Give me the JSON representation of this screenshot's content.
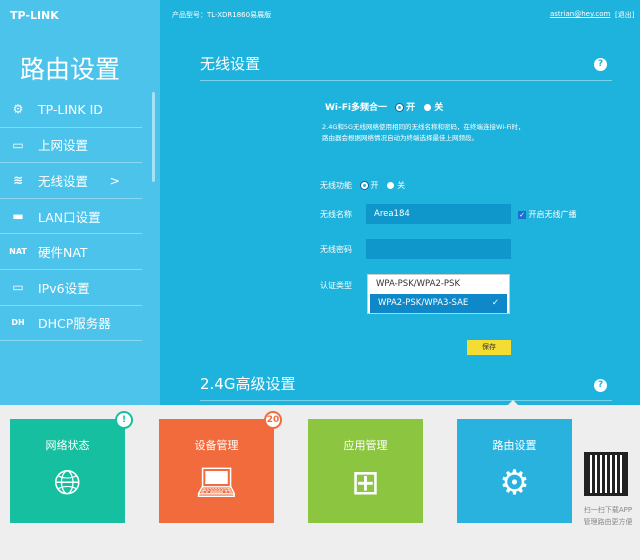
{
  "brand": "TP-LINK",
  "sidebar": {
    "title": "路由设置",
    "items": [
      {
        "icon": "gear-icon",
        "glyph": "⚙",
        "label": "TP-LINK ID"
      },
      {
        "icon": "laptop-icon",
        "glyph": "▭",
        "label": "上网设置"
      },
      {
        "icon": "wifi-icon",
        "glyph": "≋",
        "label": "无线设置",
        "chevron": ">"
      },
      {
        "icon": "switch-icon",
        "glyph": "▬",
        "label": "LAN口设置"
      },
      {
        "icon": "nat-icon",
        "glyph": "NAT",
        "label": "硬件NAT"
      },
      {
        "icon": "laptop-icon",
        "glyph": "▭",
        "label": "IPv6设置"
      },
      {
        "icon": "dhcp-icon",
        "glyph": "DH",
        "label": "DHCP服务器"
      }
    ]
  },
  "header": {
    "model": "产品型号：TL-XDR1860易展版",
    "user": "astrian@hey.com",
    "logout": "[退出]"
  },
  "wireless": {
    "title": "无线设置",
    "multiband_label": "Wi-Fi多频合一",
    "on": "开",
    "off": "关",
    "desc1": "2.4G和5G无线网络使用相同的无线名称和密码，在终端连接Wi-Fi时，",
    "desc2": "路由器会根据网络情况自动为终端选择最佳上网频段。",
    "func_label": "无线功能",
    "ssid_label": "无线名称",
    "ssid": "Area184",
    "broadcast": "开启无线广播",
    "pwd_label": "无线密码",
    "pwd": "",
    "auth_label": "认证类型",
    "auth_options": [
      "WPA-PSK/WPA2-PSK",
      "WPA2-PSK/WPA3-SAE"
    ],
    "auth_selected": "WPA2-PSK/WPA3-SAE",
    "save": "保存"
  },
  "advanced": {
    "title": "2.4G高级设置"
  },
  "tiles": [
    {
      "label": "网络状态",
      "badge": "!",
      "color": "#17bfa1"
    },
    {
      "label": "设备管理",
      "badge": "20",
      "color": "#f26b3d"
    },
    {
      "label": "应用管理",
      "color": "#8cc540"
    },
    {
      "label": "路由设置",
      "color": "#2ab2de"
    }
  ],
  "qr": {
    "line1": "扫一扫下载APP",
    "line2": "管理路由更方便"
  }
}
